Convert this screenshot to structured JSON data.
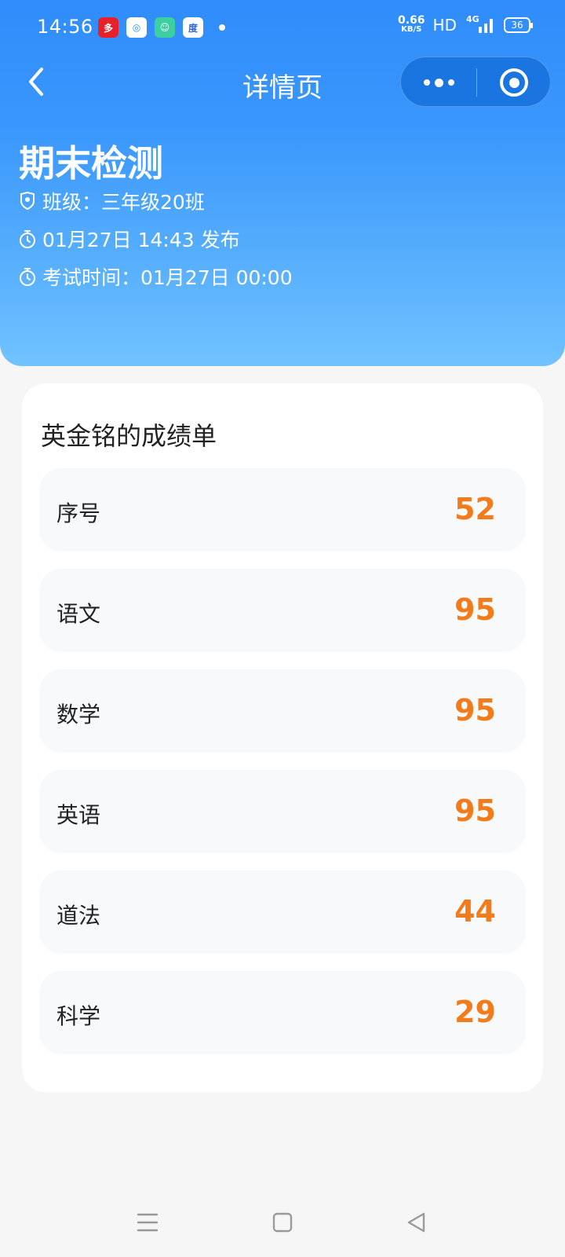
{
  "status_bar": {
    "time": "14:56",
    "notifications": [
      {
        "icon": "shopping-app-icon",
        "bg": "#e8202a",
        "glyph": "多"
      },
      {
        "icon": "browser-app-icon",
        "bg": "#ffffff",
        "glyph": "◎"
      },
      {
        "icon": "chat-app-icon",
        "bg": "#3ccfa0",
        "glyph": "☺"
      },
      {
        "icon": "baidu-app-icon",
        "bg": "#ffffff",
        "glyph": "度"
      }
    ],
    "net_speed_value": "0.66",
    "net_speed_unit": "KB/S",
    "hd_label": "HD",
    "network_label": "4G",
    "battery": "36"
  },
  "nav": {
    "title": "详情页"
  },
  "exam": {
    "title": "期末检测",
    "class_info": "班级：三年级20班",
    "publish_info": "01月27日 14:43 发布",
    "exam_time_info": "考试时间：01月27日 00:00"
  },
  "report": {
    "title": "英金铭的成绩单",
    "rows": [
      {
        "label": "序号",
        "value": "52"
      },
      {
        "label": "语文",
        "value": "95"
      },
      {
        "label": "数学",
        "value": "95"
      },
      {
        "label": "英语",
        "value": "95"
      },
      {
        "label": "道法",
        "value": "44"
      },
      {
        "label": "科学",
        "value": "29"
      }
    ]
  },
  "colors": {
    "header_blue": "#2f8cfb",
    "score_orange": "#f27b1b"
  }
}
